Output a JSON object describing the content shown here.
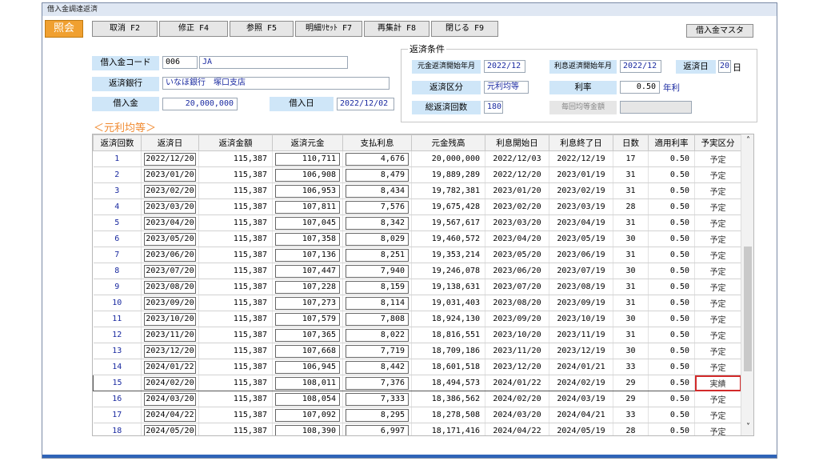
{
  "window": {
    "title": "借入金調達返済"
  },
  "mode_label": "照会",
  "fkeys": [
    {
      "label": "取消 F2"
    },
    {
      "label": "修正 F4"
    },
    {
      "label": "参照 F5"
    },
    {
      "label": "明細ﾘｾｯﾄ F7"
    },
    {
      "label": "再集計 F8"
    },
    {
      "label": "閉じる F9"
    }
  ],
  "master_button": "借入金マスタ",
  "loan": {
    "code_label": "借入金コード",
    "code": "006",
    "code_name": "JA",
    "bank_label": "返済銀行",
    "bank": "いなほ銀行　塚口支店",
    "amount_label": "借入金",
    "amount": "20,000,000",
    "date_label": "借入日",
    "date": "2022/12/02"
  },
  "conditions": {
    "legend": "返済条件",
    "principal_start_label": "元金返済開始年月",
    "principal_start": "2022/12",
    "interest_start_label": "利息返済開始年月",
    "interest_start": "2022/12",
    "payday_label": "返済日",
    "payday": "20",
    "payday_unit": "日",
    "type_label": "返済区分",
    "type": "元利均等",
    "rate_label": "利率",
    "rate": "0.50",
    "rate_unit": "年利",
    "count_label": "総返済回数",
    "count": "180",
    "equal_label": "毎回均等金額",
    "equal": ""
  },
  "section_title": "＜元利均等＞",
  "columns": [
    "返済回数",
    "返済日",
    "返済金額",
    "返済元金",
    "支払利息",
    "元金残高",
    "利息開始日",
    "利息終了日",
    "日数",
    "適用利率",
    "予実区分"
  ],
  "rows": [
    [
      "1",
      "2022/12/20",
      "115,387",
      "110,711",
      "4,676",
      "20,000,000",
      "2022/12/03",
      "2022/12/19",
      "17",
      "0.50",
      "予定"
    ],
    [
      "2",
      "2023/01/20",
      "115,387",
      "106,908",
      "8,479",
      "19,889,289",
      "2022/12/20",
      "2023/01/19",
      "31",
      "0.50",
      "予定"
    ],
    [
      "3",
      "2023/02/20",
      "115,387",
      "106,953",
      "8,434",
      "19,782,381",
      "2023/01/20",
      "2023/02/19",
      "31",
      "0.50",
      "予定"
    ],
    [
      "4",
      "2023/03/20",
      "115,387",
      "107,811",
      "7,576",
      "19,675,428",
      "2023/02/20",
      "2023/03/19",
      "28",
      "0.50",
      "予定"
    ],
    [
      "5",
      "2023/04/20",
      "115,387",
      "107,045",
      "8,342",
      "19,567,617",
      "2023/03/20",
      "2023/04/19",
      "31",
      "0.50",
      "予定"
    ],
    [
      "6",
      "2023/05/20",
      "115,387",
      "107,358",
      "8,029",
      "19,460,572",
      "2023/04/20",
      "2023/05/19",
      "30",
      "0.50",
      "予定"
    ],
    [
      "7",
      "2023/06/20",
      "115,387",
      "107,136",
      "8,251",
      "19,353,214",
      "2023/05/20",
      "2023/06/19",
      "31",
      "0.50",
      "予定"
    ],
    [
      "8",
      "2023/07/20",
      "115,387",
      "107,447",
      "7,940",
      "19,246,078",
      "2023/06/20",
      "2023/07/19",
      "30",
      "0.50",
      "予定"
    ],
    [
      "9",
      "2023/08/20",
      "115,387",
      "107,228",
      "8,159",
      "19,138,631",
      "2023/07/20",
      "2023/08/19",
      "31",
      "0.50",
      "予定"
    ],
    [
      "10",
      "2023/09/20",
      "115,387",
      "107,273",
      "8,114",
      "19,031,403",
      "2023/08/20",
      "2023/09/19",
      "31",
      "0.50",
      "予定"
    ],
    [
      "11",
      "2023/10/20",
      "115,387",
      "107,579",
      "7,808",
      "18,924,130",
      "2023/09/20",
      "2023/10/19",
      "30",
      "0.50",
      "予定"
    ],
    [
      "12",
      "2023/11/20",
      "115,387",
      "107,365",
      "8,022",
      "18,816,551",
      "2023/10/20",
      "2023/11/19",
      "31",
      "0.50",
      "予定"
    ],
    [
      "13",
      "2023/12/20",
      "115,387",
      "107,668",
      "7,719",
      "18,709,186",
      "2023/11/20",
      "2023/12/19",
      "30",
      "0.50",
      "予定"
    ],
    [
      "14",
      "2024/01/22",
      "115,387",
      "106,945",
      "8,442",
      "18,601,518",
      "2023/12/20",
      "2024/01/21",
      "33",
      "0.50",
      "予定"
    ],
    [
      "15",
      "2024/02/20",
      "115,387",
      "108,011",
      "7,376",
      "18,494,573",
      "2024/01/22",
      "2024/02/19",
      "29",
      "0.50",
      "実績"
    ],
    [
      "16",
      "2024/03/20",
      "115,387",
      "108,054",
      "7,333",
      "18,386,562",
      "2024/02/20",
      "2024/03/19",
      "29",
      "0.50",
      "予定"
    ],
    [
      "17",
      "2024/04/22",
      "115,387",
      "107,092",
      "8,295",
      "18,278,508",
      "2024/03/20",
      "2024/04/21",
      "33",
      "0.50",
      "予定"
    ],
    [
      "18",
      "2024/05/20",
      "115,387",
      "108,390",
      "6,997",
      "18,171,416",
      "2024/04/22",
      "2024/05/19",
      "28",
      "0.50",
      "予定"
    ]
  ],
  "scroll_up": "˄",
  "scroll_down": "˅",
  "colors": {
    "mode_bg": "#f0a030",
    "label_bg": "#cfe6f8",
    "highlight": "#d22a2a",
    "section": "#f08a30"
  }
}
